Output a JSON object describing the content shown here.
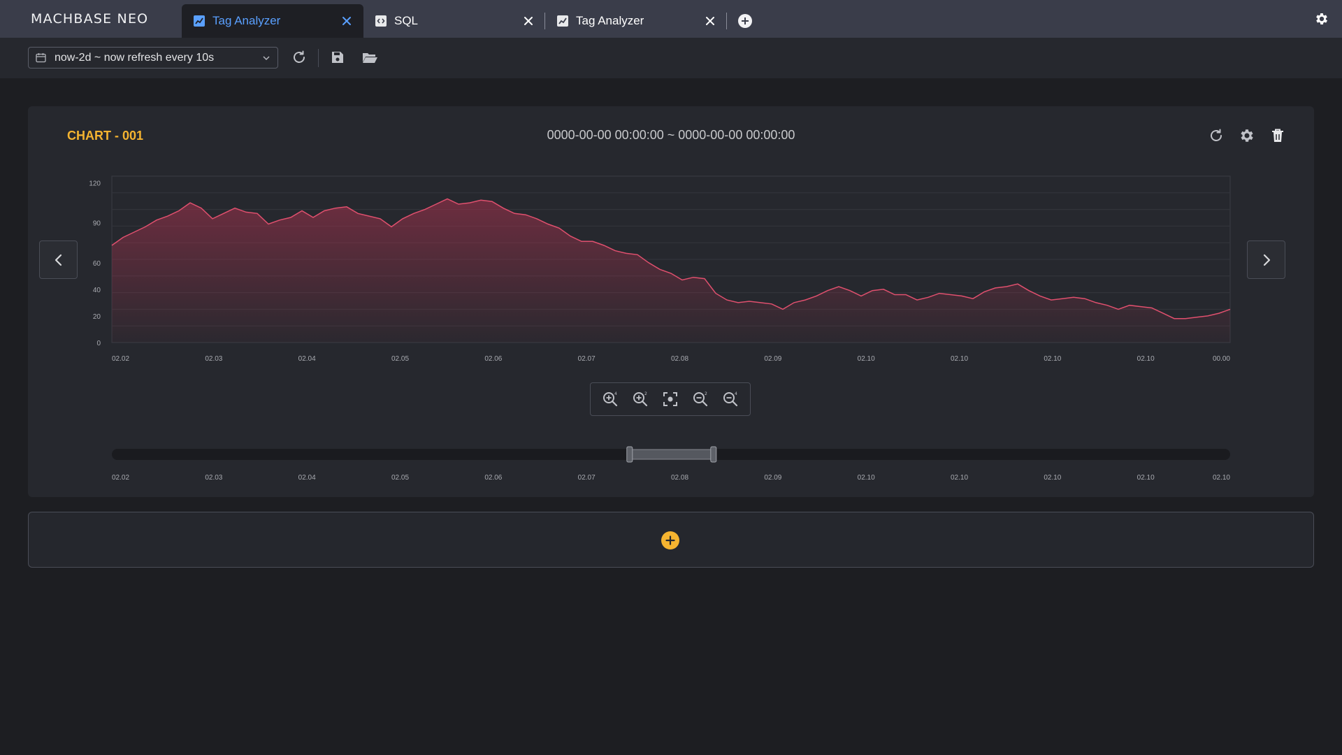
{
  "app": {
    "logo": "MACHBASE NEO"
  },
  "tabs": [
    {
      "label": "Tag Analyzer",
      "icon": "chart-line-icon",
      "active": true
    },
    {
      "label": "SQL",
      "icon": "sql-icon",
      "active": false
    },
    {
      "label": "Tag Analyzer",
      "icon": "chart-line-icon",
      "active": false
    }
  ],
  "toolbar": {
    "time_range": "now-2d ~ now refresh every 10s",
    "icons": [
      "calendar-icon",
      "chevron-down-icon",
      "refresh-icon",
      "save-icon",
      "folder-open-icon"
    ]
  },
  "chart_panel": {
    "title": "CHART - 001",
    "range_text": "0000-00-00 00:00:00 ~ 0000-00-00 00:00:00",
    "icons": [
      "refresh-icon",
      "gear-icon",
      "trash-icon",
      "chevron-left-icon",
      "chevron-right-icon"
    ]
  },
  "zoom_controls": [
    "zoom-in-4x-icon",
    "zoom-in-2x-icon",
    "focus-icon",
    "zoom-out-2x-icon",
    "zoom-out-4x-icon"
  ],
  "chart_data": {
    "type": "area",
    "title": "",
    "xlabel": "",
    "ylabel": "",
    "ylim": [
      0,
      125
    ],
    "y_ticks": [
      0,
      20,
      40,
      60,
      90,
      120
    ],
    "x_tick_labels": [
      "02.02",
      "02.03",
      "02.04",
      "02.05",
      "02.06",
      "02.07",
      "02.08",
      "02.09",
      "02.10",
      "02.10",
      "02.10",
      "02.10",
      "00.00"
    ],
    "grid": true,
    "color": "#e0506e",
    "series": [
      {
        "x": [
          0,
          1,
          2,
          3,
          4,
          5,
          6,
          7,
          8,
          9,
          10,
          11,
          12,
          13,
          14,
          15,
          16,
          17,
          18,
          19,
          20,
          21,
          22,
          23,
          24,
          25,
          26,
          27,
          28,
          29,
          30,
          31,
          32,
          33,
          34,
          35,
          36,
          37,
          38,
          39,
          40,
          41,
          42,
          43,
          44,
          45,
          46,
          47,
          48,
          49,
          50,
          51,
          52,
          53,
          54,
          55,
          56,
          57,
          58,
          59,
          60,
          61,
          62,
          63,
          64,
          65,
          66,
          67,
          68,
          69,
          70,
          71,
          72,
          73,
          74,
          75,
          76,
          77,
          78,
          79,
          80,
          81,
          82,
          83,
          84,
          85,
          86,
          87,
          88,
          89,
          90,
          91,
          92,
          93,
          94,
          95,
          96,
          97,
          98,
          99,
          100
        ],
        "values": [
          73,
          79,
          83,
          87,
          92,
          95,
          99,
          105,
          101,
          93,
          97,
          101,
          98,
          97,
          89,
          92,
          94,
          99,
          94,
          99,
          101,
          102,
          97,
          95,
          93,
          87,
          93,
          97,
          100,
          104,
          108,
          104,
          105,
          107,
          106,
          101,
          97,
          96,
          93,
          89,
          86,
          80,
          76,
          76,
          73,
          69,
          67,
          66,
          60,
          55,
          52,
          47,
          49,
          48,
          37,
          32,
          30,
          31,
          30,
          29,
          25,
          30,
          32,
          35,
          39,
          42,
          39,
          35,
          39,
          40,
          36,
          36,
          32,
          34,
          37,
          36,
          35,
          33,
          38,
          41,
          42,
          44,
          39,
          35,
          32,
          33,
          34,
          33,
          30,
          28,
          25,
          28,
          27,
          26,
          22,
          18,
          18,
          19,
          20,
          22,
          25
        ]
      }
    ]
  },
  "navigator": {
    "x_tick_labels": [
      "02.02",
      "02.03",
      "02.04",
      "02.05",
      "02.06",
      "02.07",
      "02.08",
      "02.09",
      "02.10",
      "02.10",
      "02.10",
      "02.10",
      "02.10"
    ],
    "selection": [
      0.463,
      0.538
    ]
  }
}
